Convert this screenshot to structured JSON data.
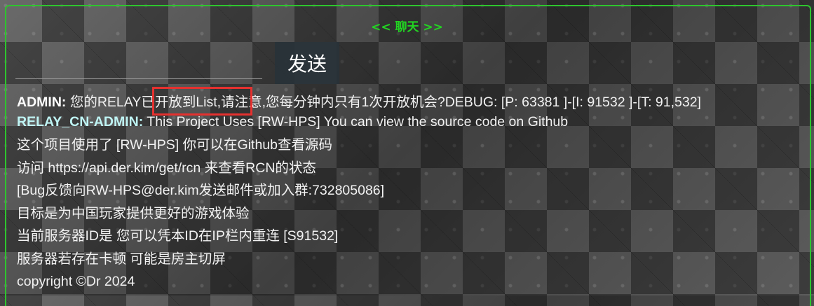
{
  "chat_panel": {
    "title": "<< 聊天 >>",
    "send_label": "发送",
    "highlight_color": "#e5312f",
    "messages": [
      {
        "sender": "ADMIN:",
        "text": " 您的RELAY已开放到List,请注意,您每分钟内只有1次开放机会?DEBUG: [P: 63381 ]-[I: 91532 ]-[T: 91,532]"
      },
      {
        "sender": "RELAY_CN-ADMIN:",
        "text": " This Project Uses [RW-HPS] You can view the source code on Github"
      }
    ],
    "lines": [
      "这个项目使用了 [RW-HPS] 你可以在Github查看源码",
      "访问 https://api.der.kim/get/rcn 来查看RCN的状态",
      "[Bug反馈向RW-HPS@der.kim发送邮件或加入群:732805086]",
      "目标是为中国玩家提供更好的游戏体验",
      "当前服务器ID是 您可以凭本ID在IP栏内重连 [S91532]",
      "服务器若存在卡顿 可能是房主切屏",
      "copyright ©Dr 2024"
    ]
  }
}
